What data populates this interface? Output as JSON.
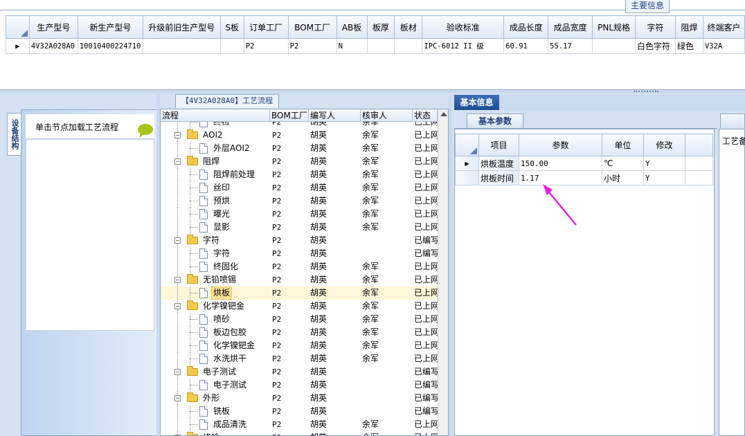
{
  "top_panel": {
    "tab_label": "主要信息",
    "columns": [
      "生产型号",
      "新生产型号",
      "升级前旧生产型号",
      "S板",
      "订单工厂",
      "BOM工厂",
      "AB板",
      "板厚",
      "板材",
      "验收标准",
      "成品长度",
      "成品宽度",
      "PNL规格",
      "字符",
      "阻焊",
      "终端客户"
    ],
    "row": [
      "4V32A028A0",
      "10010400224710",
      "",
      "",
      "P2",
      "P2",
      "N",
      "",
      "",
      "IPC-6012 II 级",
      "60.91",
      "55.17",
      "",
      "白色字符",
      "绿色",
      "V32A"
    ]
  },
  "left_panel": {
    "vertical_tab": "设备结构",
    "hint": "单击节点加载工艺流程"
  },
  "process_panel": {
    "title": "【4V32A028A0】工艺流程",
    "columns": [
      "流程",
      "BOM工厂",
      "编写人",
      "核审人",
      "状态"
    ],
    "rows": [
      {
        "name": "终检",
        "level": 2,
        "kind": "doc",
        "bom": "P2",
        "writer": "胡英",
        "reviewer": "余军",
        "status": "已上网"
      },
      {
        "name": "AOI2",
        "level": 1,
        "kind": "folder",
        "bom": "P2",
        "writer": "胡英",
        "reviewer": "余军",
        "status": "已上网"
      },
      {
        "name": "外层AOI2",
        "level": 2,
        "kind": "doc",
        "bom": "P2",
        "writer": "胡英",
        "reviewer": "余军",
        "status": "已上网"
      },
      {
        "name": "阻焊",
        "level": 1,
        "kind": "folder",
        "bom": "P2",
        "writer": "胡英",
        "reviewer": "余军",
        "status": "已上网"
      },
      {
        "name": "阻焊前处理",
        "level": 2,
        "kind": "doc",
        "bom": "P2",
        "writer": "胡英",
        "reviewer": "余军",
        "status": "已上网"
      },
      {
        "name": "丝印",
        "level": 2,
        "kind": "doc",
        "bom": "P2",
        "writer": "胡英",
        "reviewer": "余军",
        "status": "已上网"
      },
      {
        "name": "预烘",
        "level": 2,
        "kind": "doc",
        "bom": "P2",
        "writer": "胡英",
        "reviewer": "余军",
        "status": "已上网"
      },
      {
        "name": "曝光",
        "level": 2,
        "kind": "doc",
        "bom": "P2",
        "writer": "胡英",
        "reviewer": "余军",
        "status": "已上网"
      },
      {
        "name": "显影",
        "level": 2,
        "kind": "doc",
        "bom": "P2",
        "writer": "胡英",
        "reviewer": "余军",
        "status": "已上网"
      },
      {
        "name": "字符",
        "level": 1,
        "kind": "folder",
        "bom": "P2",
        "writer": "胡英",
        "reviewer": "",
        "status": "已编写"
      },
      {
        "name": "字符",
        "level": 2,
        "kind": "doc",
        "bom": "P2",
        "writer": "胡英",
        "reviewer": "",
        "status": "已编写"
      },
      {
        "name": "终固化",
        "level": 2,
        "kind": "doc",
        "bom": "P2",
        "writer": "胡英",
        "reviewer": "余军",
        "status": "已上网"
      },
      {
        "name": "无铅喷锡",
        "level": 1,
        "kind": "folder",
        "bom": "P2",
        "writer": "胡英",
        "reviewer": "余军",
        "status": "已上网"
      },
      {
        "name": "烘板",
        "level": 2,
        "kind": "doc",
        "bom": "P2",
        "writer": "胡英",
        "reviewer": "余军",
        "status": "已上网",
        "selected": true
      },
      {
        "name": "化学镍钯金",
        "level": 1,
        "kind": "folder",
        "bom": "P2",
        "writer": "胡英",
        "reviewer": "余军",
        "status": "已上网"
      },
      {
        "name": "喷砂",
        "level": 2,
        "kind": "doc",
        "bom": "P2",
        "writer": "胡英",
        "reviewer": "余军",
        "status": "已上网"
      },
      {
        "name": "板边包胶",
        "level": 2,
        "kind": "doc",
        "bom": "P2",
        "writer": "胡英",
        "reviewer": "余军",
        "status": "已上网"
      },
      {
        "name": "化学镍钯金",
        "level": 2,
        "kind": "doc",
        "bom": "P2",
        "writer": "胡英",
        "reviewer": "余军",
        "status": "已上网"
      },
      {
        "name": "水洗烘干",
        "level": 2,
        "kind": "doc",
        "bom": "P2",
        "writer": "胡英",
        "reviewer": "余军",
        "status": "已上网"
      },
      {
        "name": "电子测试",
        "level": 1,
        "kind": "folder",
        "bom": "P2",
        "writer": "胡英",
        "reviewer": "",
        "status": "已编写"
      },
      {
        "name": "电子测试",
        "level": 2,
        "kind": "doc",
        "bom": "P2",
        "writer": "胡英",
        "reviewer": "",
        "status": "已编写"
      },
      {
        "name": "外形",
        "level": 1,
        "kind": "folder",
        "bom": "P2",
        "writer": "胡英",
        "reviewer": "",
        "status": "已编写"
      },
      {
        "name": "铣板",
        "level": 2,
        "kind": "doc",
        "bom": "P2",
        "writer": "胡英",
        "reviewer": "",
        "status": "已编写"
      },
      {
        "name": "成品清洗",
        "level": 2,
        "kind": "doc",
        "bom": "P2",
        "writer": "胡英",
        "reviewer": "余军",
        "status": "已上网"
      },
      {
        "name": "终检",
        "level": 1,
        "kind": "folder",
        "bom": "P2",
        "writer": "胡英",
        "reviewer": "余军",
        "status": "已上网"
      }
    ]
  },
  "basic_info": {
    "tab_label": "基本信息",
    "params_tab": "基本参数",
    "columns": [
      "项目",
      "参数",
      "单位",
      "修改"
    ],
    "rows": [
      {
        "item": "烘板温度",
        "param": "150.00",
        "unit": "℃",
        "editable": "Y"
      },
      {
        "item": "烘板时间",
        "param": "1.17",
        "unit": "小时",
        "editable": "Y"
      }
    ],
    "side_label": "工艺备"
  },
  "annotation_color": "#e020e0"
}
